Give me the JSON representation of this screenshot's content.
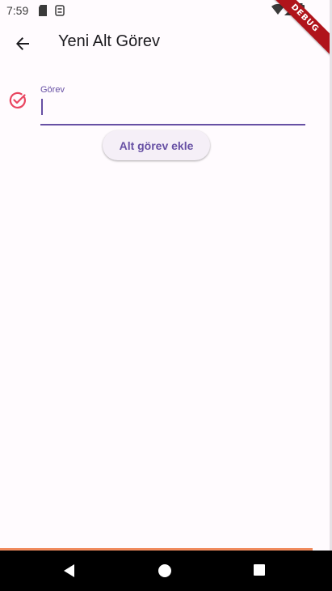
{
  "status_bar": {
    "time": "7:59",
    "icons": [
      "sd-card-icon",
      "storage-icon",
      "wifi-icon",
      "signal-icon",
      "battery-icon"
    ]
  },
  "debug_banner": "DEBUG",
  "app_bar": {
    "title": "Yeni Alt Görev",
    "back_icon": "arrow-back-icon"
  },
  "form": {
    "field_label": "Görev",
    "field_value": "",
    "icon": "check-circle-icon",
    "add_button_label": "Alt görev ekle"
  },
  "colors": {
    "primary": "#6750a4",
    "check_icon": "#e94560",
    "background": "#fffbfe",
    "debug_banner": "#b0141b",
    "bottom_line": "#f08a5d"
  },
  "nav_bar": {
    "icons": [
      "nav-back-icon",
      "nav-home-icon",
      "nav-recents-icon"
    ]
  }
}
